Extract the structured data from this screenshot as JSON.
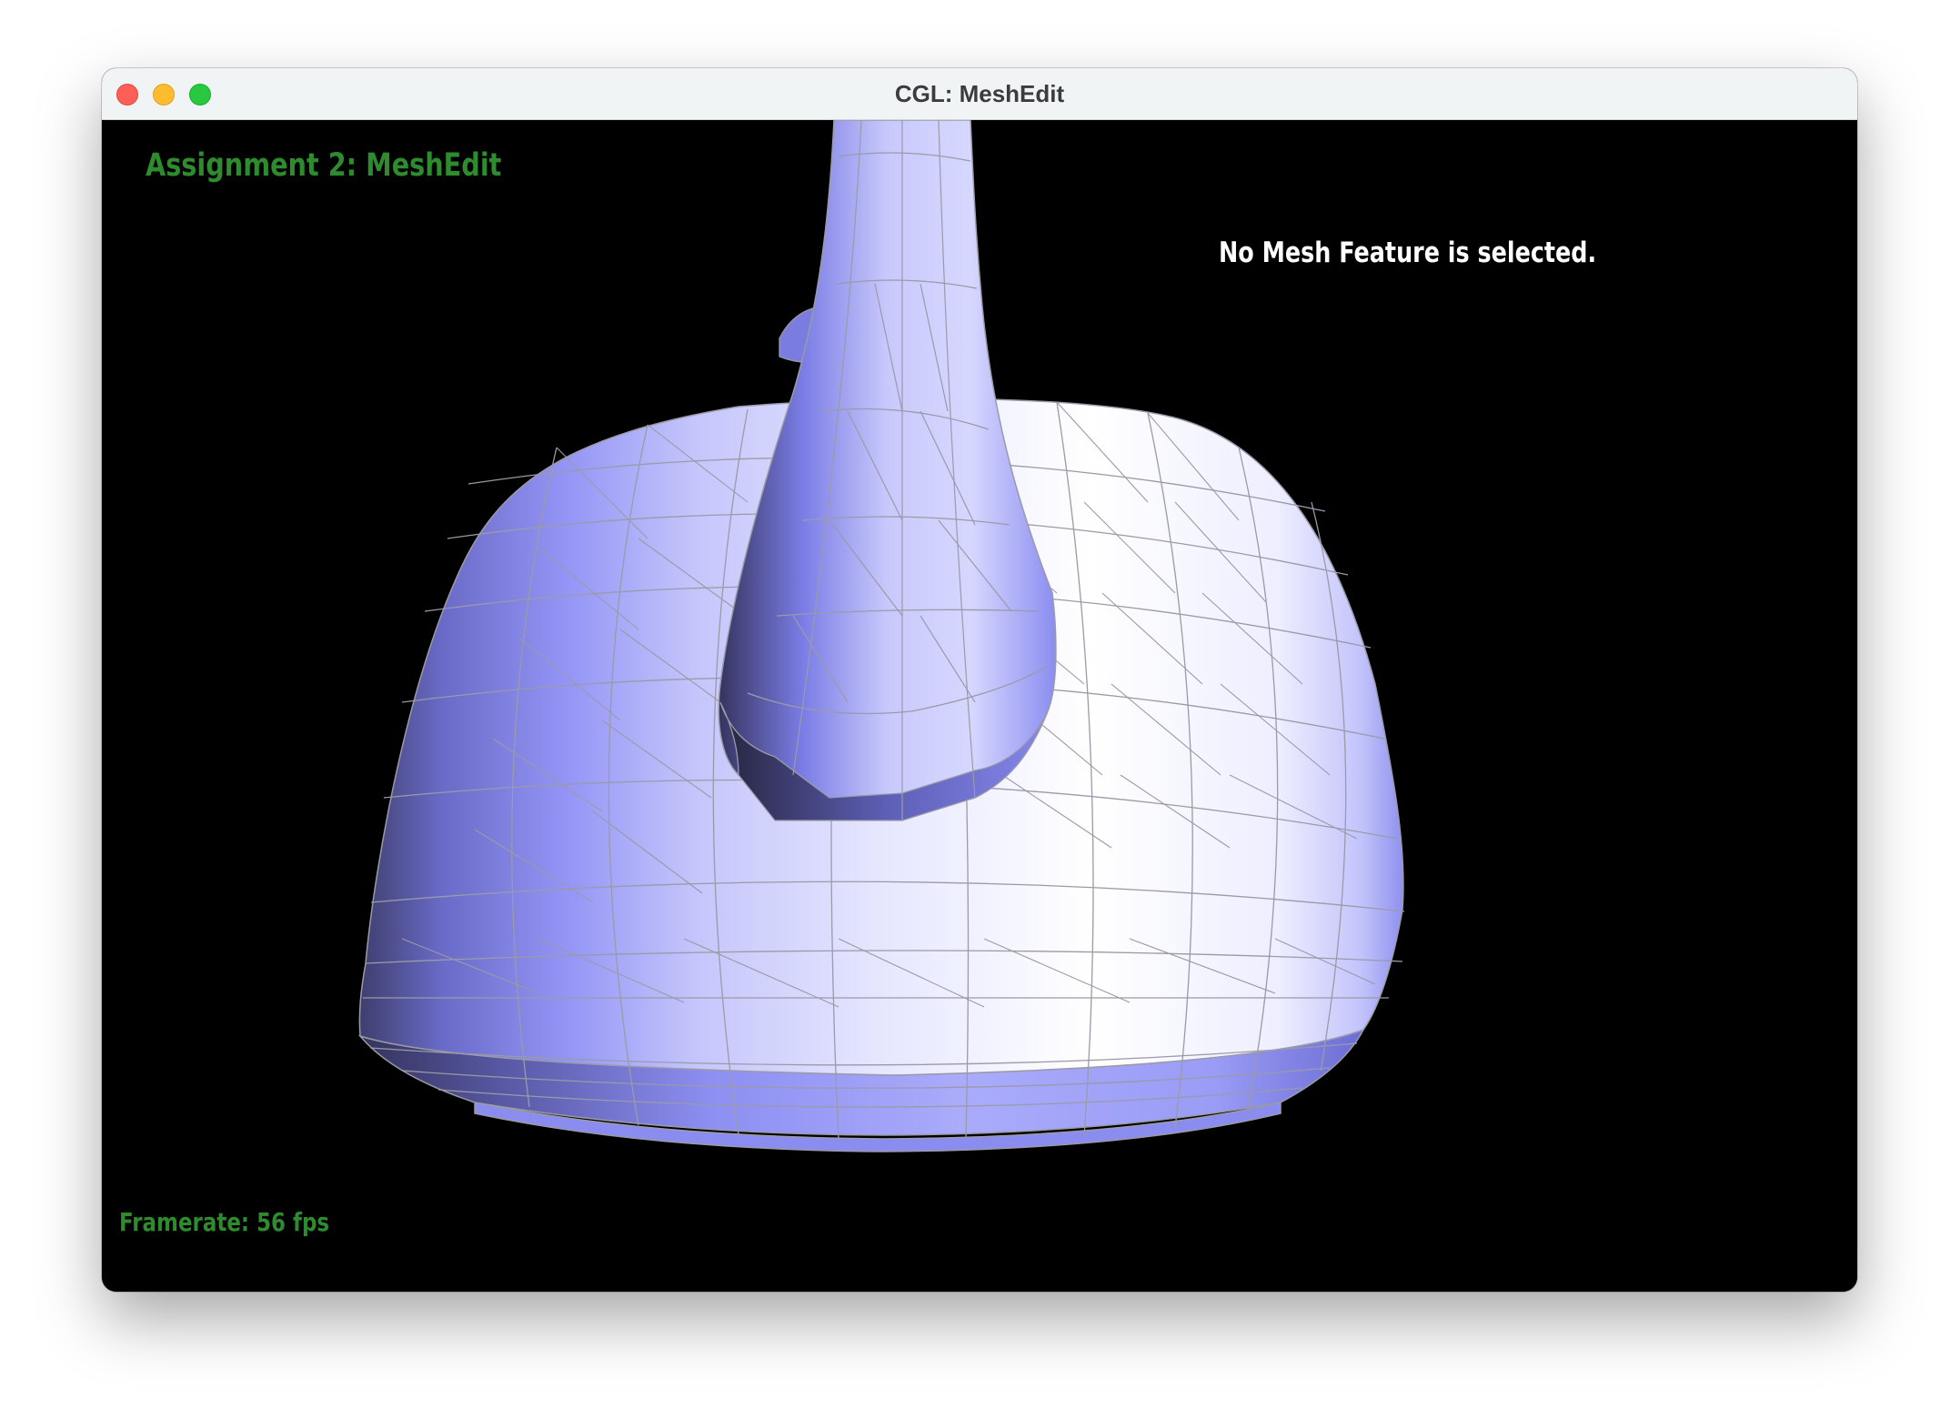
{
  "window": {
    "title": "CGL: MeshEdit",
    "controls": [
      "close",
      "minimize",
      "maximize"
    ]
  },
  "viewport": {
    "assignment_label": "Assignment 2: MeshEdit",
    "selection_status": "No Mesh Feature is selected.",
    "framerate_label": "Framerate: 56 fps",
    "mesh_description": "teapot",
    "colors": {
      "background": "#000000",
      "label_green": "#2e8b2e",
      "status_white": "#ffffff",
      "mesh_light": "#eceeff",
      "mesh_mid": "#9a9cf8",
      "mesh_dark": "#3a3a6a",
      "wire": "#9a9aa8"
    }
  }
}
